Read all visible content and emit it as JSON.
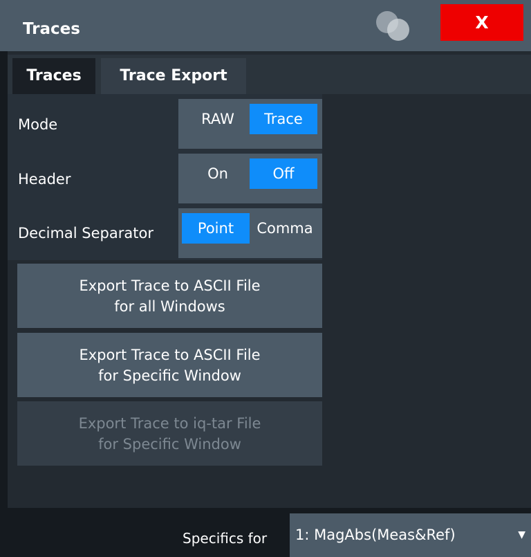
{
  "window": {
    "title": "Traces",
    "close_label": "X"
  },
  "tabs": [
    {
      "label": "Traces"
    },
    {
      "label": "Trace Export"
    }
  ],
  "settings": {
    "mode": {
      "label": "Mode",
      "options": [
        "RAW",
        "Trace"
      ],
      "selected": "Trace"
    },
    "header": {
      "label": "Header",
      "options": [
        "On",
        "Off"
      ],
      "selected": "Off"
    },
    "decimal_separator": {
      "label": "Decimal Separator",
      "options": [
        "Point",
        "Comma"
      ],
      "selected": "Point"
    }
  },
  "buttons": {
    "export_all": {
      "line1": "Export Trace to ASCII File",
      "line2": "for all Windows"
    },
    "export_specific": {
      "line1": "Export Trace to ASCII File",
      "line2": "for Specific Window"
    },
    "export_iqtar": {
      "line1": "Export Trace to iq-tar File",
      "line2": "for Specific Window"
    }
  },
  "specifics": {
    "label": "Specifics for",
    "value": "1: MagAbs(Meas&Ref)"
  },
  "colors": {
    "accent": "#0f8dfa",
    "close": "#ee0000",
    "button": "#4c5b68",
    "background": "#151a1f"
  }
}
